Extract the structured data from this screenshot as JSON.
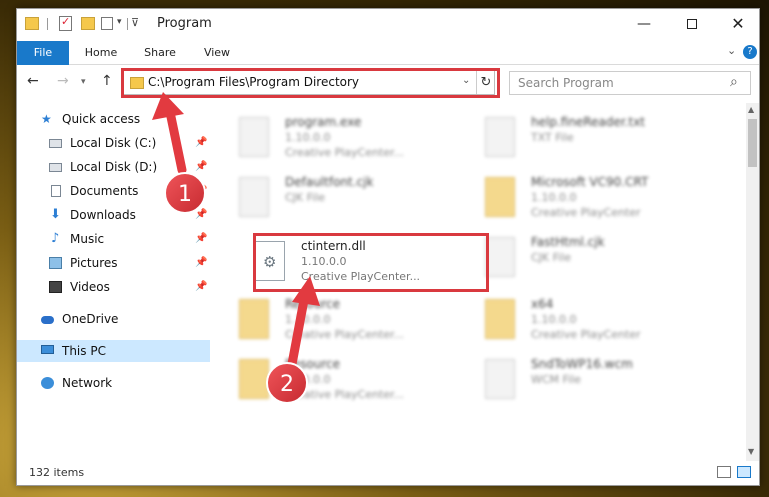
{
  "titlebar": {
    "title": "Program",
    "minimize": "—",
    "close": "✕"
  },
  "ribbon": {
    "tabs": [
      "File",
      "Home",
      "Share",
      "View"
    ],
    "help": "?"
  },
  "navbar": {
    "address": "C:\\Program Files\\Program Directory",
    "search_placeholder": "Search Program"
  },
  "navpane": {
    "items": [
      {
        "label": "Quick access",
        "icon": "star-icon"
      },
      {
        "label": "Local Disk (C:)",
        "icon": "disk-icon",
        "pinned": true
      },
      {
        "label": "Local Disk (D:)",
        "icon": "disk-icon",
        "pinned": true
      },
      {
        "label": "Documents",
        "icon": "document-icon",
        "pinned": true
      },
      {
        "label": "Downloads",
        "icon": "download-icon",
        "pinned": true
      },
      {
        "label": "Music",
        "icon": "music-icon",
        "pinned": true
      },
      {
        "label": "Pictures",
        "icon": "pictures-icon",
        "pinned": true
      },
      {
        "label": "Videos",
        "icon": "videos-icon",
        "pinned": true
      },
      {
        "label": "OneDrive",
        "icon": "cloud-icon"
      },
      {
        "label": "This PC",
        "icon": "computer-icon",
        "selected": true
      },
      {
        "label": "Network",
        "icon": "network-icon"
      }
    ]
  },
  "files": [
    {
      "name": "program.exe",
      "line1": "1.10.0.0",
      "line2": "Creative PlayCenter..."
    },
    {
      "name": "help.fineReader.txt",
      "line1": "TXT File",
      "line2": ""
    },
    {
      "name": "Defaultfont.cjk",
      "line1": "CJK File",
      "line2": ""
    },
    {
      "name": "Microsoft VC90.CRT",
      "line1": "1.10.0.0",
      "line2": "Creative PlayCenter"
    },
    {
      "name": "ctintern.dll",
      "line1": "1.10.0.0",
      "line2": "Creative PlayCenter..."
    },
    {
      "name": "FastHtml.cjk",
      "line1": "CJK File",
      "line2": ""
    },
    {
      "name": "Resource",
      "line1": "1.10.0.0",
      "line2": "Creative PlayCenter..."
    },
    {
      "name": "x64",
      "line1": "1.10.0.0",
      "line2": "Creative PlayCenter"
    },
    {
      "name": "Resource",
      "line1": "1.10.0.0",
      "line2": "Creative PlayCenter..."
    },
    {
      "name": "SndToWP16.wcm",
      "line1": "WCM File",
      "line2": ""
    }
  ],
  "statusbar": {
    "item_count": "132 items"
  },
  "annotations": {
    "badge1": "1",
    "badge2": "2",
    "highlight_color": "#d9393f"
  },
  "colors": {
    "accent": "#1979ca",
    "selection": "#cce8ff",
    "folder": "#f5c84c"
  }
}
